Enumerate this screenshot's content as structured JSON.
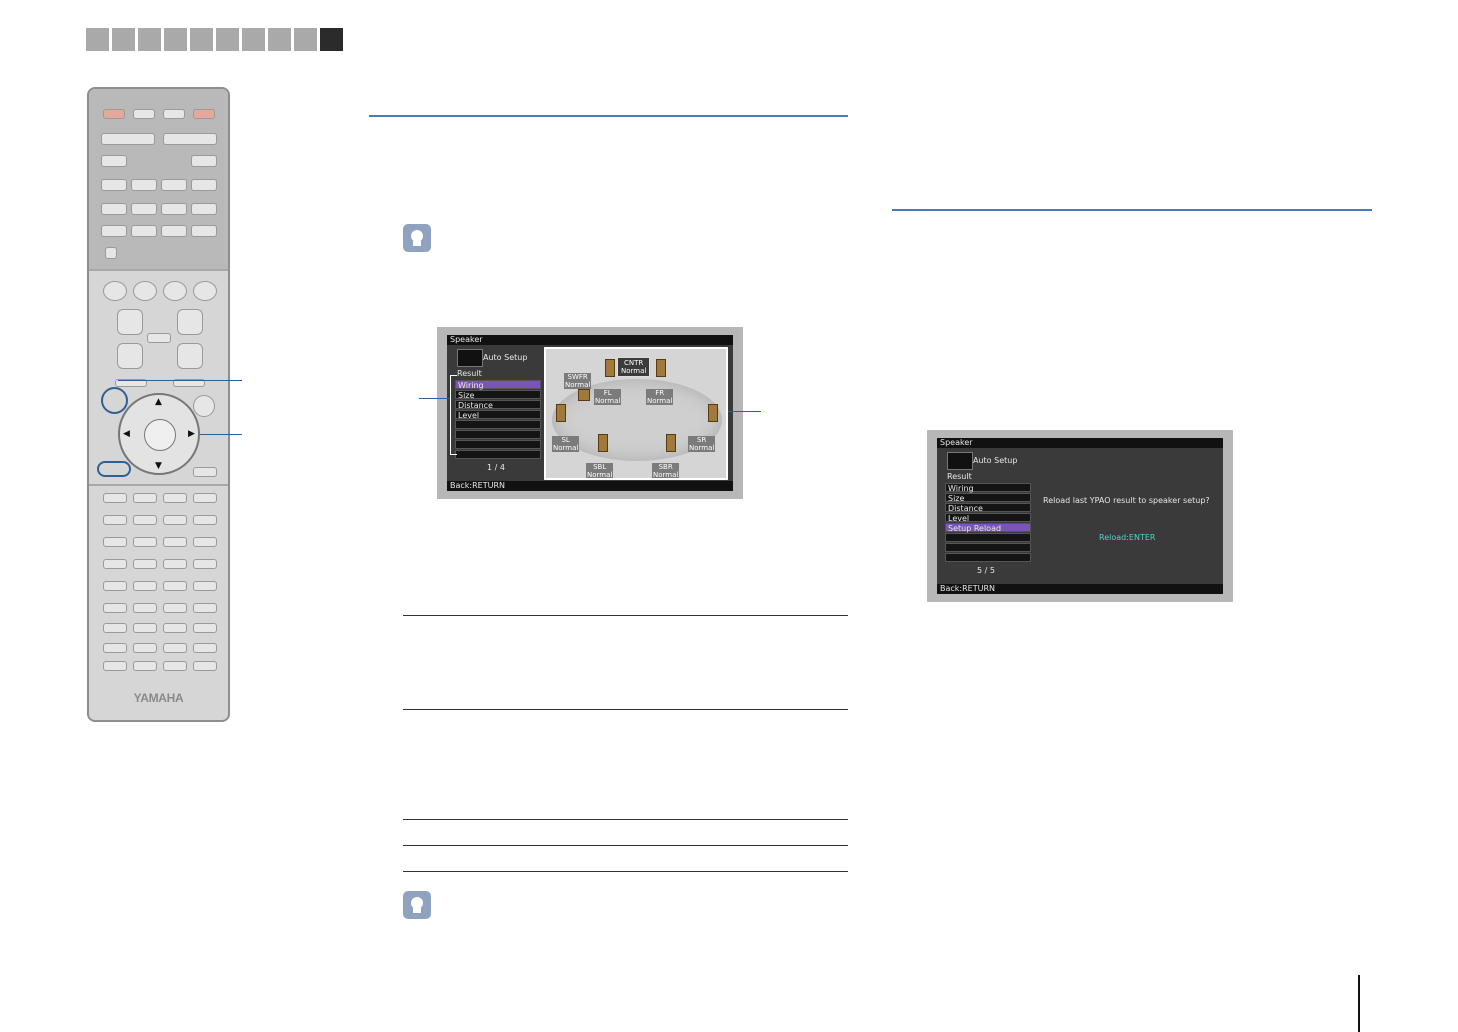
{
  "progress_tabs": {
    "count": 10,
    "active_index": 9
  },
  "remote": {
    "brand": "YAMAHA"
  },
  "screen1": {
    "header": "Speaker",
    "mode": "Auto Setup",
    "result_label": "Result",
    "menu": [
      "Wiring",
      "Size",
      "Distance",
      "Level"
    ],
    "selected_index": 0,
    "page": "1 / 4",
    "footer": "Back:RETURN",
    "speakers": {
      "cntr": {
        "name": "CNTR",
        "status": "Normal"
      },
      "swfr": {
        "name": "SWFR",
        "status": "Normal"
      },
      "fl": {
        "name": "FL",
        "status": "Normal"
      },
      "fr": {
        "name": "FR",
        "status": "Normal"
      },
      "sl": {
        "name": "SL",
        "status": "Normal"
      },
      "sr": {
        "name": "SR",
        "status": "Normal"
      },
      "sbl": {
        "name": "SBL",
        "status": "Normal"
      },
      "sbr": {
        "name": "SBR",
        "status": "Normal"
      }
    }
  },
  "screen2": {
    "header": "Speaker",
    "mode": "Auto Setup",
    "result_label": "Result",
    "menu": [
      "Wiring",
      "Size",
      "Distance",
      "Level",
      "Setup Reload"
    ],
    "selected_index": 4,
    "page": "5 / 5",
    "footer": "Back:RETURN",
    "message": "Reload last YPAO result to speaker setup?",
    "action": "Reload:ENTER"
  },
  "colors": {
    "accent_rule": "#4a7bb8",
    "selected_row": "#7a55b6",
    "action_text": "#4fd4c8"
  }
}
